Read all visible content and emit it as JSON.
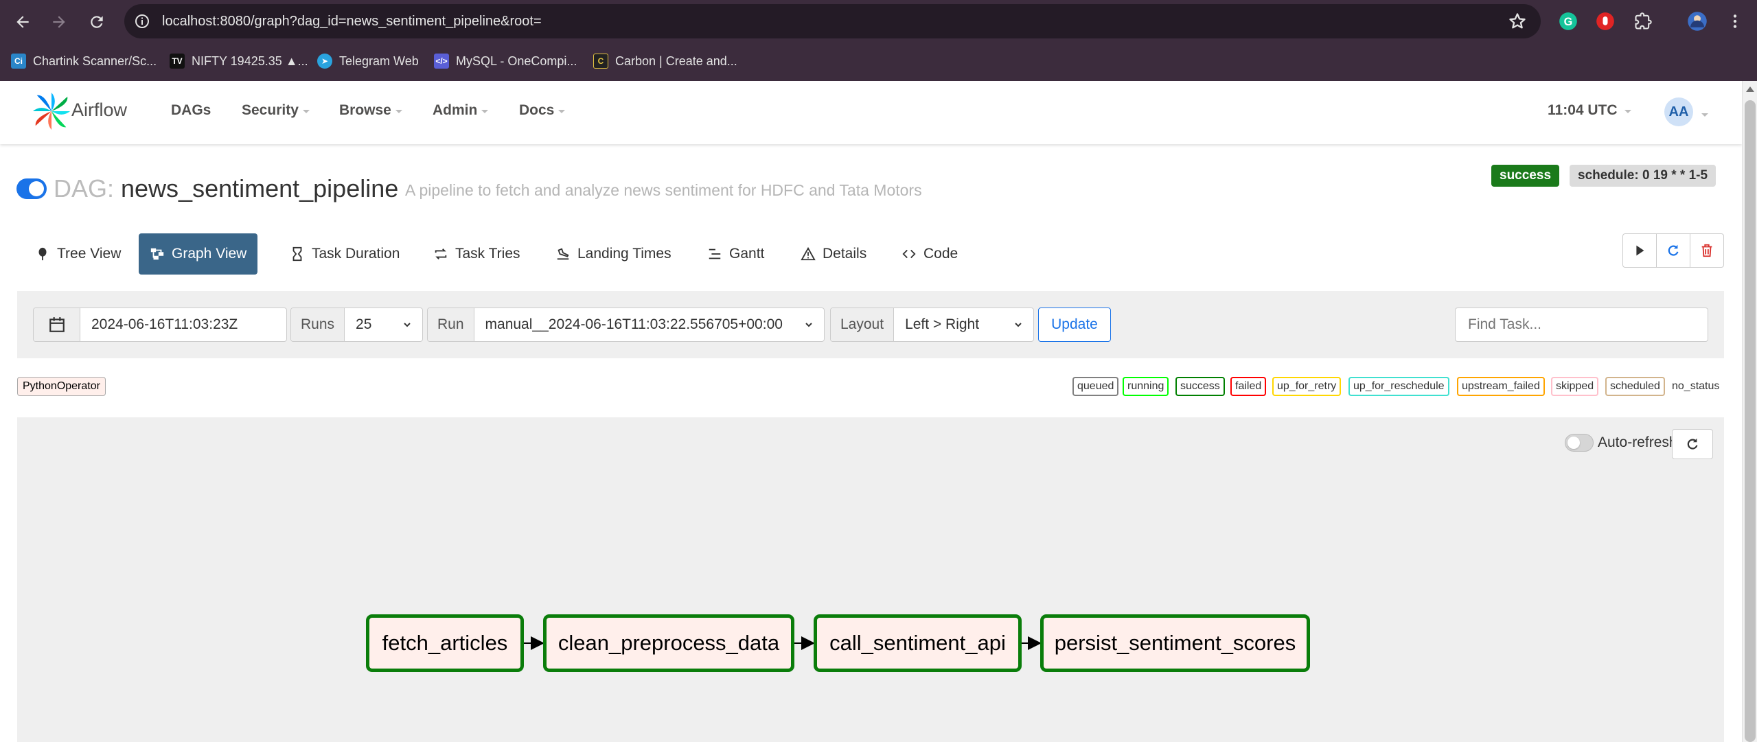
{
  "browser": {
    "url": "localhost:8080/graph?dag_id=news_sentiment_pipeline&root=",
    "bookmarks": [
      {
        "label": "Chartink Scanner/Sc...",
        "icon": "chartink-icon"
      },
      {
        "label": "NIFTY 19425.35 ▲...",
        "icon": "tradingview-icon"
      },
      {
        "label": "Telegram Web",
        "icon": "telegram-icon"
      },
      {
        "label": "MySQL - OneCompi...",
        "icon": "onecompiler-icon"
      },
      {
        "label": "Carbon | Create and...",
        "icon": "carbon-icon"
      }
    ]
  },
  "navbar": {
    "brand": "Airflow",
    "menu": {
      "dags": "DAGs",
      "security": "Security",
      "browse": "Browse",
      "admin": "Admin",
      "docs": "Docs"
    },
    "time": "11:04 UTC",
    "user_initials": "AA"
  },
  "dag": {
    "label": "DAG:",
    "id": "news_sentiment_pipeline",
    "description": "A pipeline to fetch and analyze news sentiment for HDFC and Tata Motors",
    "status": "success",
    "schedule": "schedule: 0 19 * * 1-5"
  },
  "tabs": {
    "tree": "Tree View",
    "graph": "Graph View",
    "duration": "Task Duration",
    "tries": "Task Tries",
    "landing": "Landing Times",
    "gantt": "Gantt",
    "details": "Details",
    "code": "Code"
  },
  "filters": {
    "base_date": "2024-06-16T11:03:23Z",
    "runs_label": "Runs",
    "runs_value": "25",
    "run_label": "Run",
    "run_value": "manual__2024-06-16T11:03:22.556705+00:00",
    "layout_label": "Layout",
    "layout_value": "Left > Right",
    "update": "Update",
    "find_placeholder": "Find Task..."
  },
  "legend": {
    "operator": "PythonOperator",
    "states": [
      {
        "label": "queued",
        "color": "#808080"
      },
      {
        "label": "running",
        "color": "#00ff00"
      },
      {
        "label": "success",
        "color": "#008000"
      },
      {
        "label": "failed",
        "color": "#ff0000"
      },
      {
        "label": "up_for_retry",
        "color": "#ffd700"
      },
      {
        "label": "up_for_reschedule",
        "color": "#40e0d0"
      },
      {
        "label": "upstream_failed",
        "color": "#ffa500"
      },
      {
        "label": "skipped",
        "color": "#ffc0cb"
      },
      {
        "label": "scheduled",
        "color": "#d2b48c"
      }
    ],
    "no_status": "no_status"
  },
  "graph": {
    "auto_refresh": "Auto-refresh",
    "tasks": [
      "fetch_articles",
      "clean_preprocess_data",
      "call_sentiment_api",
      "persist_sentiment_scores"
    ],
    "task_state_color": "#008000",
    "task_fill": "#ffefeb"
  }
}
